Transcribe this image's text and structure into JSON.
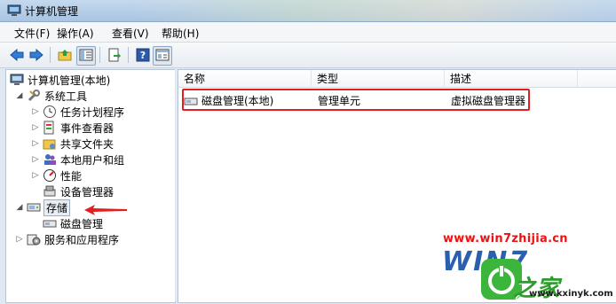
{
  "window": {
    "title": "计算机管理"
  },
  "menu": [
    "文件(F)",
    "操作(A)",
    "查看(V)",
    "帮助(H)"
  ],
  "toolbar": [
    "back-icon",
    "forward-icon",
    "up-folder-icon",
    "show-tree-icon",
    "export-icon",
    "help-icon",
    "properties-icon"
  ],
  "tree": {
    "root": "计算机管理(本地)",
    "system_tools": "系统工具",
    "task_scheduler": "任务计划程序",
    "event_viewer": "事件查看器",
    "shared_folders": "共享文件夹",
    "local_users": "本地用户和组",
    "performance": "性能",
    "device_manager": "设备管理器",
    "storage": "存储",
    "disk_management": "磁盘管理",
    "services": "服务和应用程序"
  },
  "list": {
    "columns": [
      "名称",
      "类型",
      "描述"
    ],
    "rows": [
      {
        "name": "磁盘管理(本地)",
        "type": "管理单元",
        "description": "虚拟磁盘管理器"
      }
    ]
  },
  "watermark": {
    "url": "www.win7zhijia.cn",
    "brand": "WIN7",
    "sub": "之家",
    "url2": "www.kxinyk.com"
  },
  "colors": {
    "highlight": "#e02020",
    "arrow": "#e02020"
  }
}
